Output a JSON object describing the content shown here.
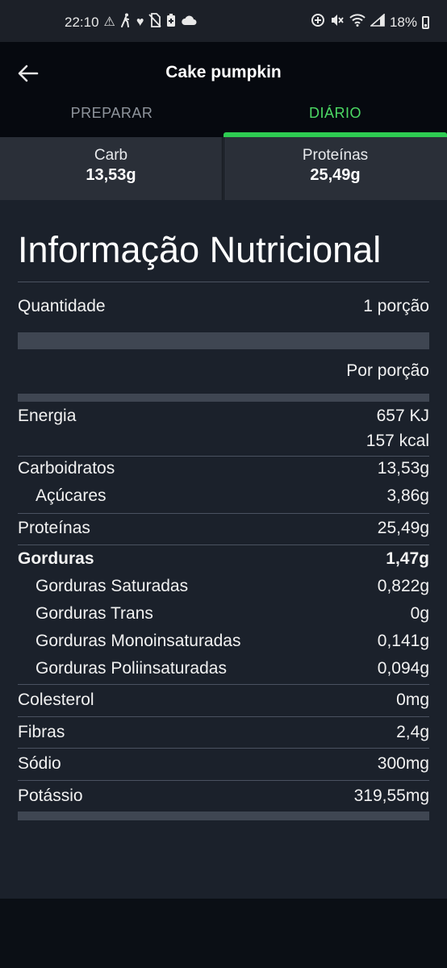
{
  "status_bar": {
    "time": "22:10",
    "left_icons": [
      "warning-icon",
      "walking-icon",
      "heart-icon",
      "no-sim-icon",
      "battery-saver-icon",
      "cloud-icon"
    ],
    "right_icons": [
      "data-saver-icon",
      "mute-icon",
      "wifi-icon",
      "signal-icon"
    ],
    "battery": "18%"
  },
  "app_bar": {
    "title": "Cake pumpkin",
    "tabs": [
      {
        "label": "PREPARAR",
        "active": false
      },
      {
        "label": "DIÁRIO",
        "active": true
      }
    ],
    "accent_color": "#2ecc52"
  },
  "macros": [
    {
      "name": "Carb",
      "value": "13,53g"
    },
    {
      "name": "Proteínas",
      "value": "25,49g"
    }
  ],
  "nutrition": {
    "title": "Informação Nutricional",
    "quantity_label": "Quantidade",
    "quantity_value": "1 porção",
    "per_label": "Por porção",
    "energy_label": "Energia",
    "energy_kj": "657 KJ",
    "energy_kcal": "157 kcal",
    "rows": [
      {
        "label": "Carboidratos",
        "value": "13,53g"
      },
      {
        "label": "Açúcares",
        "value": "3,86g"
      },
      {
        "label": "Proteínas",
        "value": "25,49g"
      },
      {
        "label": "Gorduras",
        "value": "1,47g"
      },
      {
        "label": "Gorduras Saturadas",
        "value": "0,822g"
      },
      {
        "label": "Gorduras Trans",
        "value": "0g"
      },
      {
        "label": "Gorduras Monoinsaturadas",
        "value": "0,141g"
      },
      {
        "label": "Gorduras Poliinsaturadas",
        "value": "0,094g"
      },
      {
        "label": "Colesterol",
        "value": "0mg"
      },
      {
        "label": "Fibras",
        "value": "2,4g"
      },
      {
        "label": "Sódio",
        "value": "300mg"
      },
      {
        "label": "Potássio",
        "value": "319,55mg"
      }
    ]
  }
}
